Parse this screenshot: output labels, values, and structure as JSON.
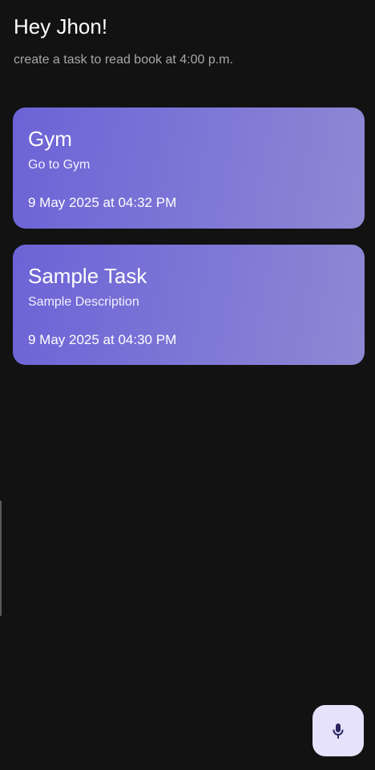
{
  "header": {
    "greeting": "Hey Jhon!",
    "hint": "create a task to read book at 4:00 p.m."
  },
  "tasks": [
    {
      "title": "Gym",
      "description": "Go to Gym",
      "datetime": "9 May 2025 at 04:32 PM"
    },
    {
      "title": "Sample Task",
      "description": "Sample Description",
      "datetime": "9 May 2025 at 04:30 PM"
    }
  ],
  "fab": {
    "icon": "microphone-icon"
  },
  "colors": {
    "background": "#121212",
    "card_gradient_start": "#6c63d6",
    "card_gradient_end": "#8e88d4",
    "fab_background": "#e6e2fb",
    "fab_icon": "#2a2660"
  }
}
